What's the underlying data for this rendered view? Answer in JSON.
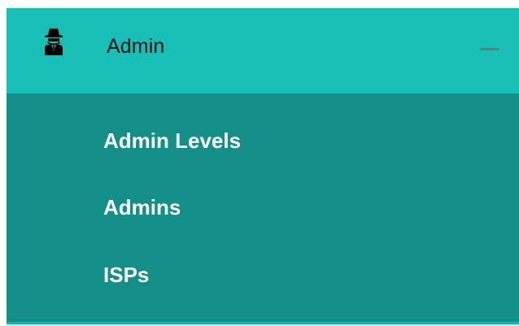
{
  "menu": {
    "header": {
      "icon": "spy-admin-icon",
      "label": "Admin",
      "collapse_icon": "minus-icon"
    },
    "items": [
      {
        "label": "Admin Levels"
      },
      {
        "label": "Admins"
      },
      {
        "label": "ISPs"
      }
    ]
  },
  "colors": {
    "header_background": "#17bfb7",
    "submenu_background": "#138f87",
    "item_text": "#ffffff",
    "header_text": "#0b1414",
    "collapse_icon": "#6e7577"
  }
}
